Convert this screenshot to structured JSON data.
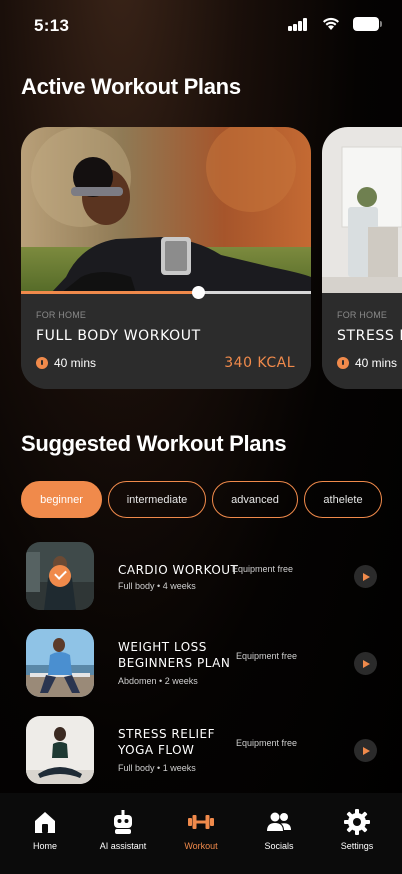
{
  "status": {
    "time": "5:13"
  },
  "active": {
    "heading": "Active Workout Plans",
    "cards": [
      {
        "tag": "FOR HOME",
        "title": "FULL BODY WORKOUT",
        "duration": "40 mins",
        "kcal": "340 KCAL",
        "progress": 0.61
      },
      {
        "tag": "FOR HOME",
        "title": "STRESS R",
        "duration": "40 mins"
      }
    ]
  },
  "suggested": {
    "heading": "Suggested Workout Plans",
    "filters": [
      {
        "label": "beginner",
        "active": true
      },
      {
        "label": "intermediate",
        "active": false
      },
      {
        "label": "advanced",
        "active": false
      },
      {
        "label": "athelete",
        "active": false
      }
    ],
    "items": [
      {
        "title_line1": "CARDIO WORKOUT",
        "title_line2": "",
        "equipment": "Equipment free",
        "area": "Full body",
        "weeks": "4 weeks",
        "completed": true
      },
      {
        "title_line1": "WEIGHT LOSS",
        "title_line2": "BEGINNERS PLAN",
        "equipment": "Equipment free",
        "area": "Abdomen",
        "weeks": "2 weeks",
        "completed": false
      },
      {
        "title_line1": "STRESS RELIEF",
        "title_line2": "YOGA FLOW",
        "equipment": "Equipment free",
        "area": "Full body",
        "weeks": "1 weeks",
        "completed": false
      }
    ]
  },
  "nav": {
    "items": [
      {
        "label": "Home",
        "icon": "home-icon"
      },
      {
        "label": "AI assistant",
        "icon": "robot-icon"
      },
      {
        "label": "Workout",
        "icon": "dumbbell-icon",
        "active": true
      },
      {
        "label": "Socials",
        "icon": "people-icon"
      },
      {
        "label": "Settings",
        "icon": "gear-icon"
      }
    ]
  },
  "colors": {
    "accent": "#f08a4b",
    "background": "#000000",
    "card": "#2c2c2c"
  }
}
